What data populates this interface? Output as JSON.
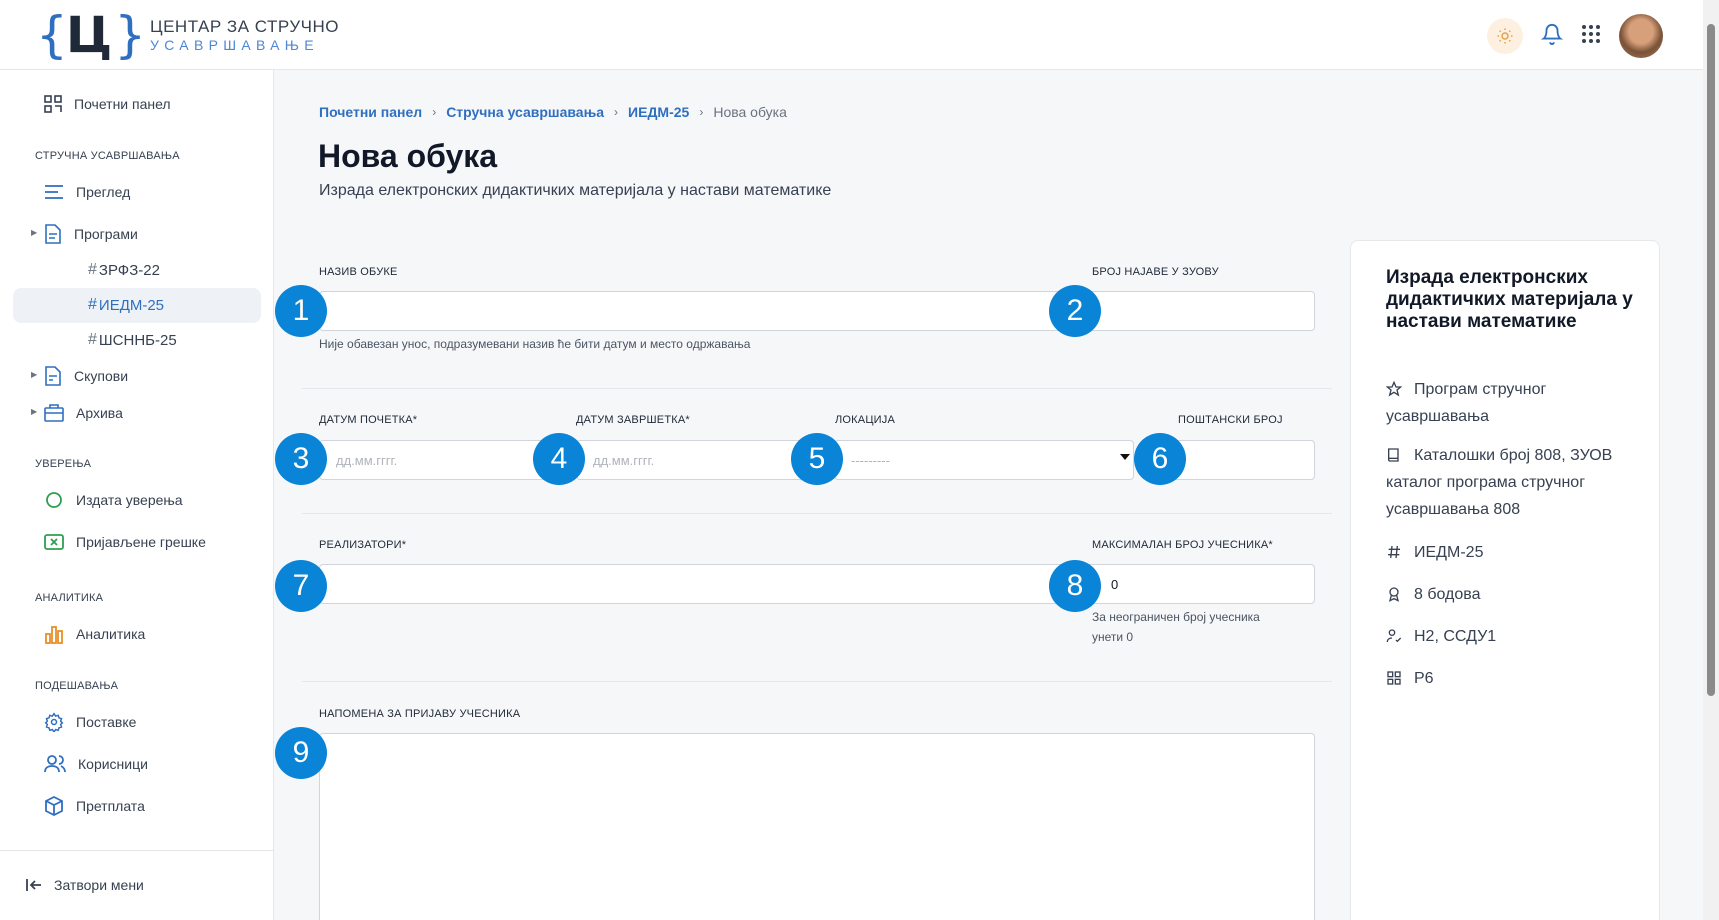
{
  "header": {
    "logo_line1": "ЦЕНТАР ЗА СТРУЧНО",
    "logo_line2": "УСАВРШАВАЊЕ",
    "logo_letter": "Ц"
  },
  "sidebar": {
    "dashboard": "Почетни панел",
    "section_training": "СТРУЧНА УСАВРШАВАЊА",
    "overview": "Преглед",
    "programs": "Програми",
    "sub_items": [
      "ЗРФЗ-22",
      "ИЕДМ-25",
      "ШСННБ-25"
    ],
    "gatherings": "Скупови",
    "archive": "Архива",
    "section_certificates": "УВЕРЕЊА",
    "issued_certificates": "Издата уверења",
    "reported_errors": "Пријављене грешке",
    "section_analytics": "АНАЛИТИКА",
    "analytics": "Аналитика",
    "section_settings": "ПОДЕШАВАЊА",
    "settings": "Поставке",
    "users": "Корисници",
    "subscription": "Претплата",
    "close_menu": "Затвори мени"
  },
  "breadcrumb": [
    "Почетни панел",
    "Стручна усавршавања",
    "ИЕДМ-25",
    "Нова обука"
  ],
  "page": {
    "title": "Нова обука",
    "subtitle": "Израда електронских дидактичких материјала у настави математике"
  },
  "form": {
    "name_label": "НАЗИВ ОБУКЕ",
    "name_hint": "Није обавезан унос, подразумевани назив ће бити датум и место одржавања",
    "announce_label": "БРОЈ НАЈАВЕ У ЗУОВУ",
    "start_label": "ДАТУМ ПОЧЕТКА*",
    "start_placeholder": "дд.мм.гггг.",
    "end_label": "ДАТУМ ЗАВРШЕТКА*",
    "end_placeholder": "дд.мм.гггг.",
    "location_label": "ЛОКАЦИЈА",
    "location_value": "---------",
    "postal_label": "ПОШТАНСКИ БРОЈ",
    "organizers_label": "РЕАЛИЗАТОРИ*",
    "max_label": "МАКСИМАЛАН БРОЈ УЧЕСНИКА*",
    "max_value": "0",
    "max_hint_1": "За неограничен број учесника",
    "max_hint_2": "унети 0",
    "note_label": "НАПОМЕНА ЗА ПРИЈАВУ УЧЕСНИКА"
  },
  "badges": [
    "1",
    "2",
    "3",
    "4",
    "5",
    "6",
    "7",
    "8",
    "9"
  ],
  "card": {
    "title": "Израда електронских дидактичких материјала у настави математике",
    "program_type": "Програм стручног усавршавања",
    "catalog": "Каталошки број 808, ЗУОВ каталог програма стручног усавршавања 808",
    "code": "ИЕДМ-25",
    "points": "8 бодова",
    "competencies": "Н2, ССДУ1",
    "priority": "Р6"
  },
  "colors": {
    "accent": "#2f6fc0",
    "badge": "#0a84d6"
  }
}
